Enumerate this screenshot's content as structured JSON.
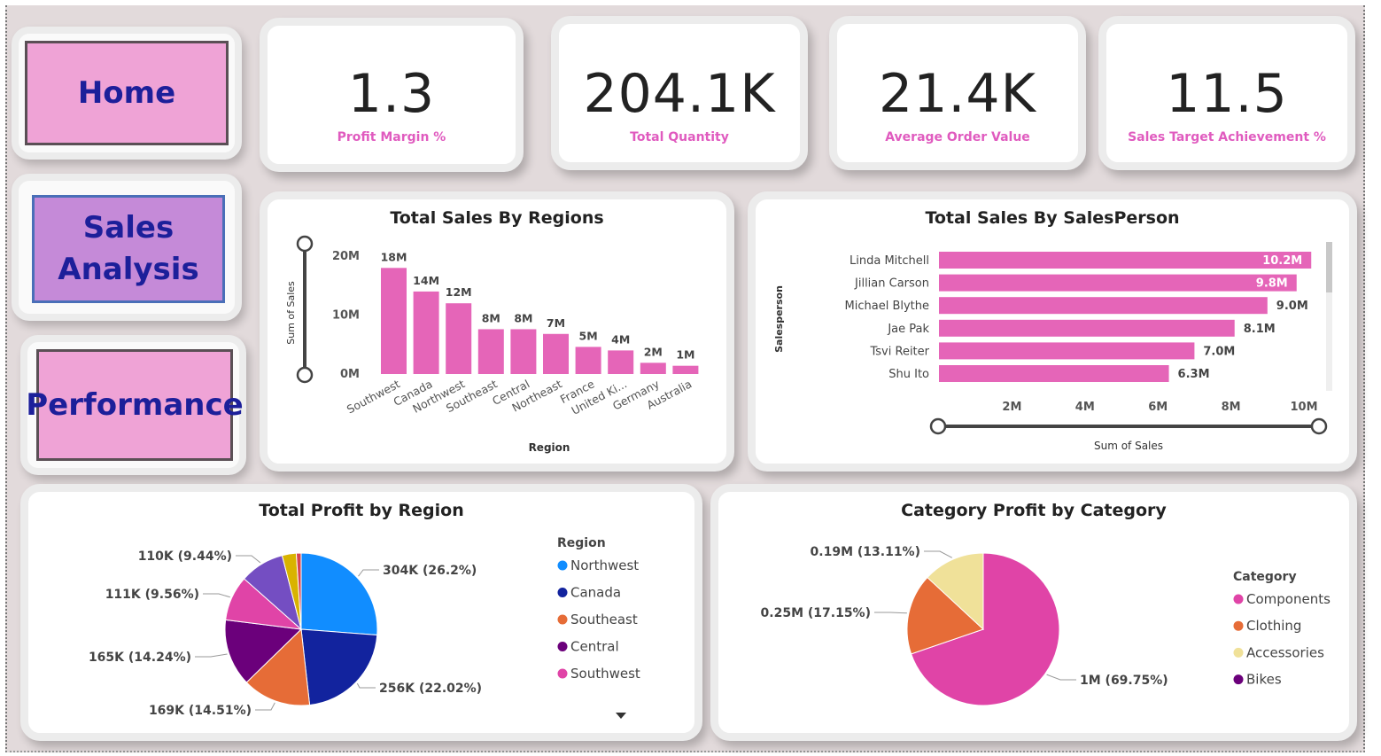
{
  "nav": {
    "home": "Home",
    "sales_analysis": "Sales Analysis",
    "performance": "Performance"
  },
  "kpis": [
    {
      "value": "1.3",
      "label": "Profit Margin %"
    },
    {
      "value": "204.1K",
      "label": "Total Quantity"
    },
    {
      "value": "21.4K",
      "label": "Average Order Value"
    },
    {
      "value": "11.5",
      "label": "Sales Target Achievement %"
    }
  ],
  "colors": {
    "pink_bar": "#e565b8",
    "kpi_label": "#e05bbf",
    "nav_text": "#1c1f9a",
    "nav_pink": "#efa3d6",
    "nav_purple": "#c58ad8"
  },
  "chart_data": [
    {
      "type": "bar",
      "title": "Total Sales By Regions",
      "xlabel": "Region",
      "ylabel": "Sum of Sales",
      "yticks": [
        "0M",
        "10M",
        "20M"
      ],
      "ylim": [
        0,
        20
      ],
      "categories": [
        "Southwest",
        "Canada",
        "Northwest",
        "Southeast",
        "Central",
        "Northeast",
        "France",
        "United Ki...",
        "Germany",
        "Australia"
      ],
      "values": [
        18,
        14,
        12,
        7.6,
        7.6,
        6.8,
        4.6,
        4,
        1.9,
        1.4
      ],
      "data_labels": [
        "18M",
        "14M",
        "12M",
        "8M",
        "8M",
        "7M",
        "5M",
        "4M",
        "2M",
        "1M"
      ],
      "color": "#e565b8"
    },
    {
      "type": "bar",
      "orientation": "horizontal",
      "title": "Total Sales By SalesPerson",
      "xlabel": "Sum of Sales",
      "ylabel": "Salesperson",
      "xticks": [
        "2M",
        "4M",
        "6M",
        "8M",
        "10M"
      ],
      "xlim": [
        0,
        10.8
      ],
      "categories": [
        "Linda Mitchell",
        "Jillian Carson",
        "Michael Blythe",
        "Jae Pak",
        "Tsvi Reiter",
        "Shu Ito"
      ],
      "values": [
        10.2,
        9.8,
        9.0,
        8.1,
        7.0,
        6.3
      ],
      "data_labels": [
        "10.2M",
        "9.8M",
        "9.0M",
        "8.1M",
        "7.0M",
        "6.3M"
      ],
      "color": "#e565b8"
    },
    {
      "type": "pie",
      "title": "Total Profit by Region",
      "legend_title": "Region",
      "legend": [
        "Northwest",
        "Canada",
        "Southeast",
        "Central",
        "Southwest"
      ],
      "slices": [
        {
          "label": "304K (26.2%)",
          "value": 26.2,
          "color": "#118dff"
        },
        {
          "label": "256K (22.02%)",
          "value": 22.02,
          "color": "#12239e"
        },
        {
          "label": "169K (14.51%)",
          "value": 14.51,
          "color": "#e66c37"
        },
        {
          "label": "165K (14.24%)",
          "value": 14.24,
          "color": "#6b007b"
        },
        {
          "label": "111K (9.56%)",
          "value": 9.56,
          "color": "#e044a7"
        },
        {
          "label": "110K (9.44%)",
          "value": 9.44,
          "color": "#744ec2"
        },
        {
          "label": "",
          "value": 3.0,
          "color": "#d9b300"
        },
        {
          "label": "",
          "value": 1.03,
          "color": "#d64550"
        }
      ]
    },
    {
      "type": "pie",
      "title": "Category Profit by Category",
      "legend_title": "Category",
      "legend": [
        "Components",
        "Clothing",
        "Accessories",
        "Bikes"
      ],
      "slices": [
        {
          "label": "1M (69.75%)",
          "value": 69.75,
          "color": "#e044a7"
        },
        {
          "label": "0.25M (17.15%)",
          "value": 17.15,
          "color": "#e66c37"
        },
        {
          "label": "0.19M (13.11%)",
          "value": 13.11,
          "color": "#f0e199"
        },
        {
          "label": "",
          "value": 0.0,
          "color": "#6b007b"
        }
      ]
    }
  ]
}
